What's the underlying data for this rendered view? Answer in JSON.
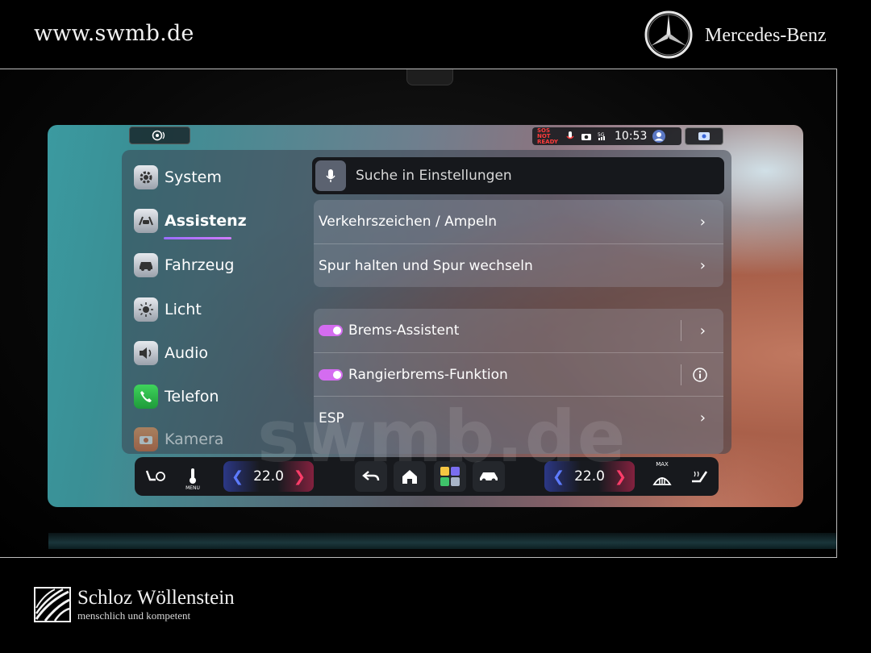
{
  "header": {
    "site_url": "www.swmb.de",
    "brand": "Mercedes-Benz"
  },
  "watermark": "swmb.de",
  "status_bar": {
    "sos_label": "SOS NOT READY",
    "time": "10:53"
  },
  "sidebar": {
    "items": [
      {
        "label": "System",
        "icon": "gear-icon"
      },
      {
        "label": "Assistenz",
        "icon": "car-assist-icon",
        "active": true
      },
      {
        "label": "Fahrzeug",
        "icon": "car-icon"
      },
      {
        "label": "Licht",
        "icon": "light-icon"
      },
      {
        "label": "Audio",
        "icon": "speaker-icon"
      },
      {
        "label": "Telefon",
        "icon": "phone-icon"
      },
      {
        "label": "Kamera",
        "icon": "camera-icon"
      }
    ]
  },
  "search": {
    "placeholder": "Suche in Einstellungen"
  },
  "settings": {
    "group1": [
      {
        "label": "Verkehrszeichen / Ampeln"
      },
      {
        "label": "Spur halten und Spur wechseln"
      }
    ],
    "group2": [
      {
        "label": "Brems-Assistent",
        "toggle": true
      },
      {
        "label": "Rangierbrems-Funktion",
        "toggle": true
      },
      {
        "label": "ESP"
      }
    ]
  },
  "climate": {
    "left_temp": "22.0",
    "right_temp": "22.0",
    "menu_label": "MENU",
    "max_label": "MAX"
  },
  "footer": {
    "dealer_name": "Schloz Wöllenstein",
    "slogan": "menschlich und kompetent"
  },
  "colors": {
    "accent_purple": "#d46cf0",
    "temp_down": "#5d7bff",
    "temp_up": "#ff3d6a",
    "sos_red": "#ff3b3b"
  }
}
